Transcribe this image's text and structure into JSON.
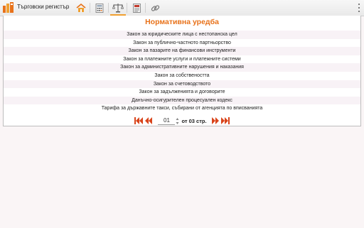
{
  "app": {
    "title": "Търговски регистър"
  },
  "toolbar": {
    "buttons": [
      {
        "name": "home-icon"
      },
      {
        "name": "calculator-icon"
      },
      {
        "name": "scales-icon",
        "active": true
      },
      {
        "name": "document-icon"
      },
      {
        "name": "link-icon"
      }
    ],
    "accent_color": "#f0a030"
  },
  "main": {
    "title": "Нормативна уредба",
    "title_color": "#e8721a",
    "laws": [
      "Закон за юридическите лица с нестопанска цел",
      "Закон за публично-частното партньорство",
      "Закон за пазарите на финансови инструменти",
      "Закон за платежните услуги и платежните системи",
      "Закон за административните нарушения и наказания",
      "Закон за собствеността",
      "Закон за счетоводството",
      "Закон за задълженията и договорите",
      "Данъчно-осигурителен процесуален кодекс",
      "Тарифа за държавните такси, събирани от агенцията по вписванията"
    ]
  },
  "pager": {
    "current_page": "01",
    "page_info": "от 03 стр."
  }
}
